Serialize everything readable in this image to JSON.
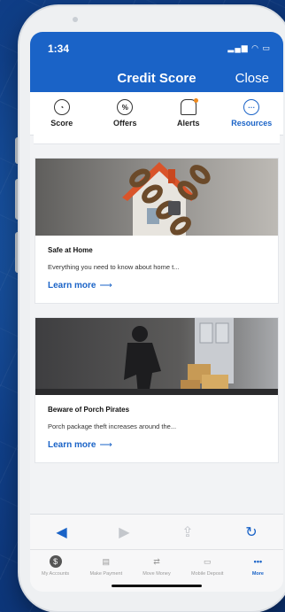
{
  "status": {
    "time": "1:34",
    "icons": "▂▄▆ ◠ ▭"
  },
  "header": {
    "title": "Credit Score",
    "close": "Close"
  },
  "tabs": [
    {
      "label": "Score",
      "icon": "gauge-icon"
    },
    {
      "label": "Offers",
      "icon": "percent-icon"
    },
    {
      "label": "Alerts",
      "icon": "bell-icon"
    },
    {
      "label": "Resources",
      "icon": "more-icon"
    }
  ],
  "cards": [
    {
      "title": "Safe at Home",
      "desc": "Everything you need to know about home t...",
      "link": "Learn more",
      "image": "chained-house-icon"
    },
    {
      "title": "Beware of Porch Pirates",
      "desc": "Porch package theft increases around the...",
      "link": "Learn more",
      "image": "porch-thief-icon"
    }
  ],
  "toolbar": {
    "back": "◀",
    "forward": "▶",
    "share": "⇪",
    "refresh": "↻"
  },
  "bottom_nav": [
    {
      "label": "My Accounts",
      "icon": "$"
    },
    {
      "label": "Make Payment",
      "icon": "▤"
    },
    {
      "label": "Move Money",
      "icon": "⇄"
    },
    {
      "label": "Mobile Deposit",
      "icon": "▭"
    },
    {
      "label": "More",
      "icon": "•••"
    }
  ],
  "colors": {
    "brand": "#1a63c7",
    "alert_dot": "#f08a1c"
  }
}
